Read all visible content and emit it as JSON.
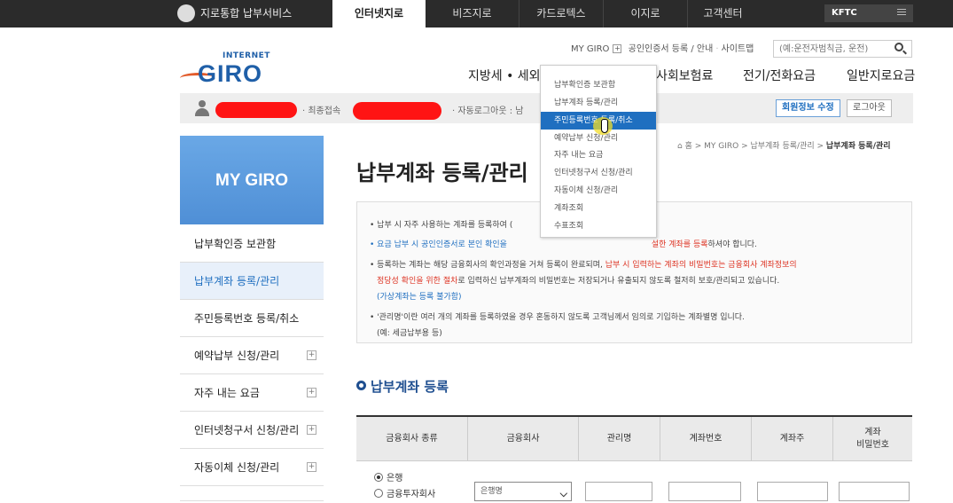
{
  "top_nav": {
    "brand": "지로통합 납부서비스",
    "tabs": [
      "인터넷지로",
      "비즈지로",
      "카드로텍스",
      "이지로",
      "고객센터"
    ],
    "kftc": "KFTC"
  },
  "header": {
    "logo_internet": "INTERNET",
    "logo_giro": "GIRO",
    "util": {
      "my_giro": "MY GIRO",
      "toggle": "+",
      "cert": "공인인증서 등록 / 안내",
      "sep": "·",
      "sitemap": "사이트맵"
    },
    "search_placeholder": "(예:운전자범칙금, 운전)",
    "gnb": [
      "지방세 • 세외수",
      "사회보험료",
      "전기/전화요금",
      "일반지로요금"
    ]
  },
  "userbar": {
    "last_login": "· 최종접속",
    "auto_logout": "· 자동로그아웃 : 남",
    "edit_btn": "회원정보 수정",
    "logout_btn": "로그아웃"
  },
  "dropdown": [
    "납부확인증 보관함",
    "납부계좌 등록/관리",
    "주민등록번호 등록/취소",
    "예약납부 신청/관리",
    "자주 내는 요금",
    "인터넷청구서 신청/관리",
    "자동이체 신청/관리",
    "계좌조회",
    "수표조회"
  ],
  "sidebar": {
    "title": "MY GIRO",
    "items": [
      {
        "label": "납부확인증 보관함",
        "plus": ""
      },
      {
        "label": "납부계좌 등록/관리",
        "plus": ""
      },
      {
        "label": "주민등록번호 등록/취소",
        "plus": ""
      },
      {
        "label": "예약납부 신청/관리",
        "plus": "+"
      },
      {
        "label": "자주 내는 요금",
        "plus": "+"
      },
      {
        "label": "인터넷청구서 신청/관리",
        "plus": "+"
      },
      {
        "label": "자동이체 신청/관리",
        "plus": "+"
      }
    ]
  },
  "breadcrumb": {
    "home": "⌂ 홈 > MY GIRO > 납부계좌 등록/관리 > ",
    "current": "납부계좌 등록/관리"
  },
  "page_title": "납부계좌 등록/관리",
  "info": {
    "l1": "• 납부 시 자주 사용하는 계좌를 등록하여 (",
    "l2a": "• 요금 납부 시 공인인증서로 본인 확인을 ",
    "l2b": "설한 계좌를 등록",
    "l2c": "하셔야 합니다.",
    "l3a": "• 등록하는 계좌는 해당 금융회사의 확인과정을 거쳐 등록이 완료되며, ",
    "l3b": "납부 시 입력하는 계좌의 비밀번호는 금융회사 계좌정보의",
    "l4a": "정당성 확인을 위한 절차",
    "l4b": "로 입력하신 납부계좌의 비밀번호는 저장되거나 유출되지 않도록 철저히 보호/관리되고 있습니다.",
    "l5": "(가상계좌는 등록 불가함)",
    "l6": "• '관리명'이란 여러 개의 계좌를 등록하였을 경우 혼동하지 않도록 고객님께서 임의로 기입하는 계좌별명 입니다.",
    "l7": "(예: 세금납부용 등)"
  },
  "section_title": "납부계좌 등록",
  "table": {
    "headers": [
      "금융회사 종류",
      "금융회사",
      "관리명",
      "계좌번호",
      "계좌주",
      "계좌\n비밀번호"
    ],
    "radio_bank": "은행",
    "radio_invest": "금융투자회사",
    "select_value": "은행명"
  }
}
